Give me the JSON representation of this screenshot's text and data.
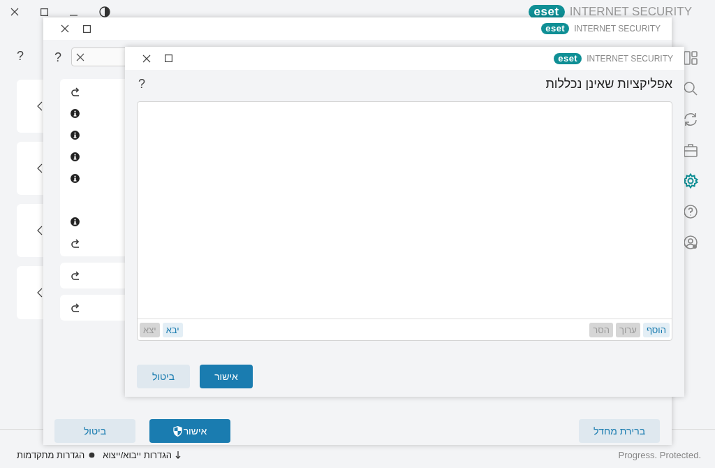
{
  "background_app": {
    "logo_text": "eset",
    "product": "INTERNET SECURITY",
    "help": "?",
    "nav_items": [
      {
        "selected": false
      },
      {
        "selected": false
      },
      {
        "selected": false
      },
      {
        "selected": false
      },
      {
        "selected": true
      },
      {
        "selected": false
      },
      {
        "selected": false
      }
    ],
    "status_left": [
      {
        "kind": "transfer",
        "label": "הגדרות ייבוא/ייצוא"
      },
      {
        "kind": "settings",
        "label": "הגדרות מתקדמות"
      }
    ],
    "status_right": "Progress. Protected."
  },
  "settings_window": {
    "logo_text": "eset",
    "product": "INTERNET SECURITY",
    "help": "?",
    "groups": [
      {
        "rows": [
          {
            "kind": "redo"
          },
          {
            "kind": "info"
          },
          {
            "kind": "info"
          },
          {
            "kind": "info"
          },
          {
            "kind": "info"
          },
          {
            "kind": "blank"
          },
          {
            "kind": "info"
          },
          {
            "kind": "redo"
          }
        ]
      },
      {
        "rows": [
          {
            "kind": "redo"
          }
        ]
      },
      {
        "rows": [
          {
            "kind": "redo"
          }
        ]
      }
    ],
    "buttons": [
      {
        "kind": "default",
        "label": "ברירת מחדל"
      },
      {
        "kind": "confirm",
        "label": "אישור"
      },
      {
        "kind": "cancel",
        "label": "ביטול"
      }
    ]
  },
  "dialog": {
    "logo_text": "eset",
    "product": "INTERNET SECURITY",
    "title": "אפליקציות שאינן נכללות",
    "help": "?",
    "list_actions": [
      {
        "label": "הוסף",
        "disabled": false
      },
      {
        "label": "ערוך",
        "disabled": true
      },
      {
        "label": "הסר",
        "disabled": true
      }
    ],
    "file_actions": [
      {
        "label": "יבא",
        "disabled": false
      },
      {
        "label": "יצא",
        "disabled": true
      }
    ],
    "buttons": [
      {
        "kind": "primary",
        "label": "אישור"
      },
      {
        "kind": "secondary",
        "label": "ביטול"
      }
    ]
  }
}
